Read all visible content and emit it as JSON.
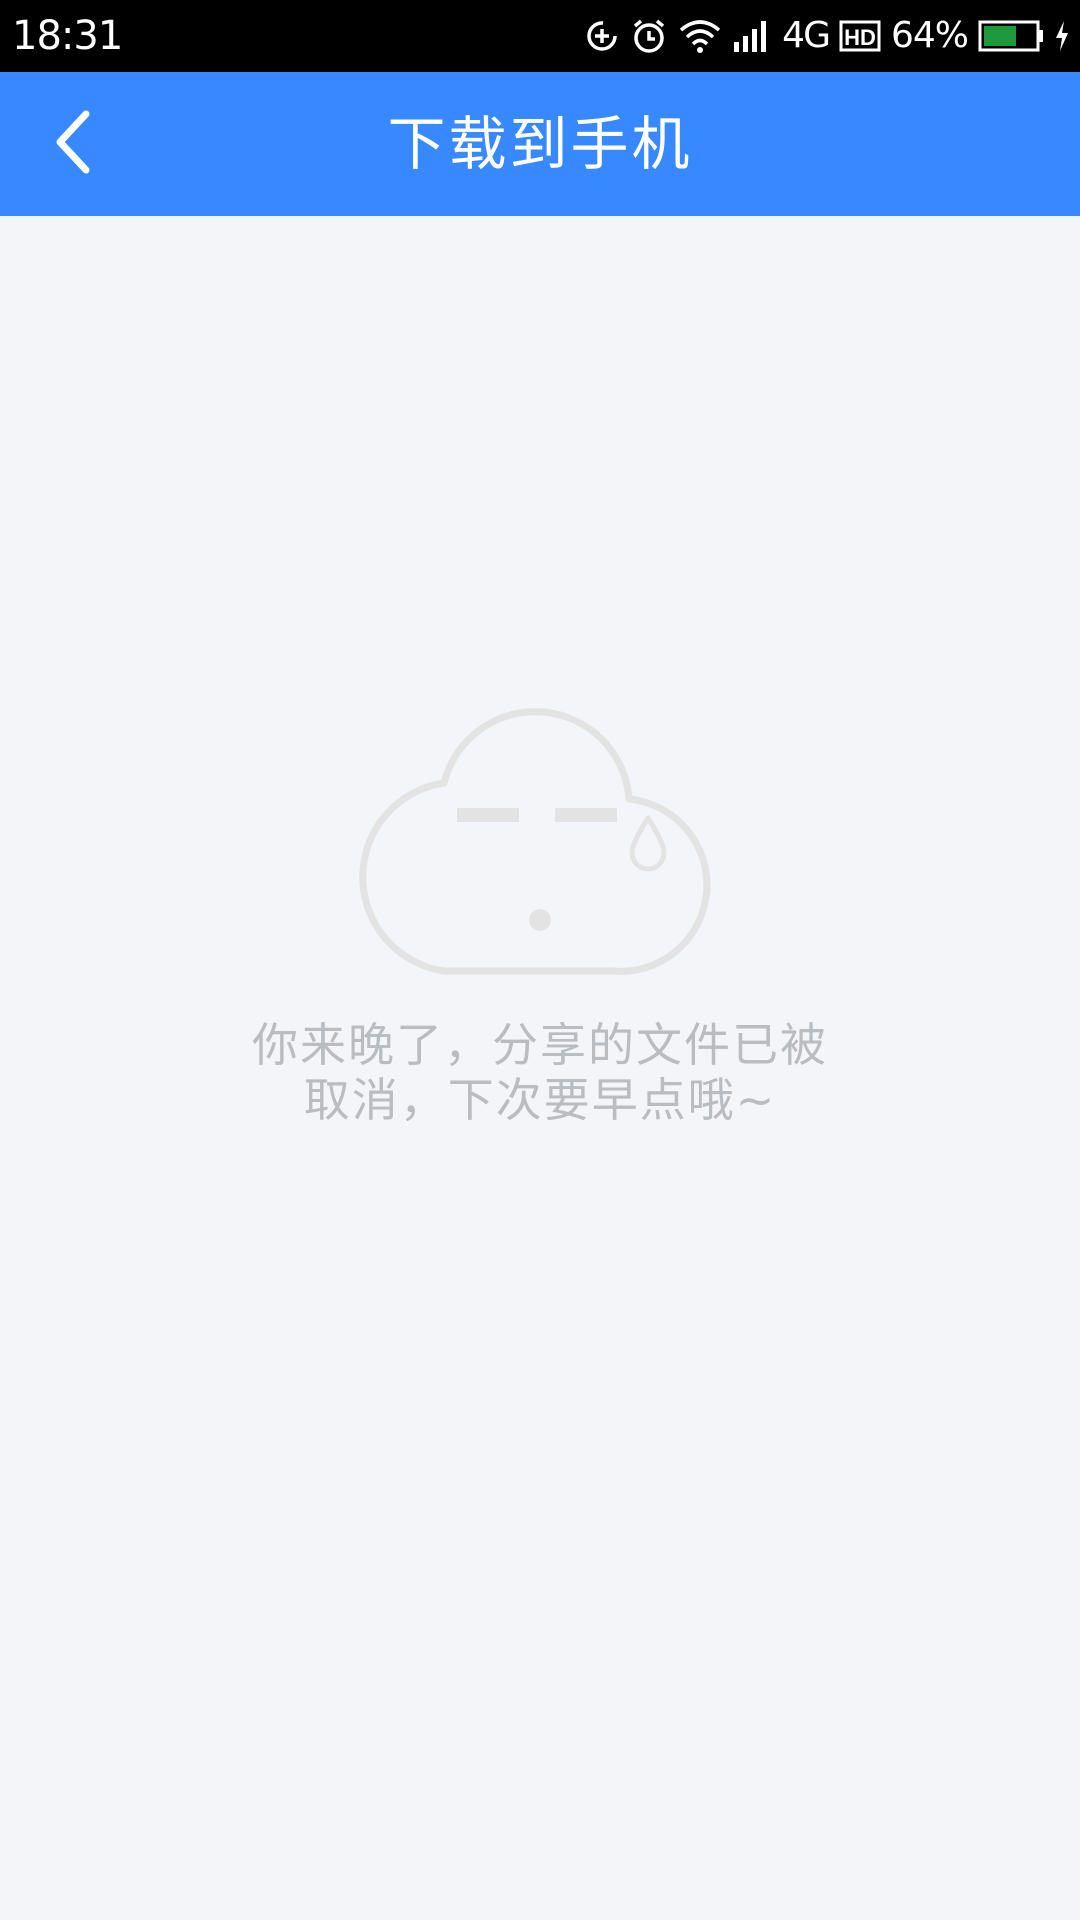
{
  "status_bar": {
    "time": "18:31",
    "network": "4G",
    "hd_badge": "HD",
    "battery_percent": "64%",
    "battery_level": 0.64,
    "battery_color": "#1e9a3c",
    "icons": [
      "sync-icon",
      "alarm-icon",
      "wifi-icon",
      "signal-icon",
      "hd-icon",
      "battery-icon",
      "charging-icon"
    ]
  },
  "app_bar": {
    "background": "#3889ff",
    "title": "下载到手机",
    "back_icon": "chevron-left-icon"
  },
  "empty_state": {
    "illustration": "sad-cloud-icon",
    "message_line1": "你来晚了，分享的文件已被",
    "message_line2": "取消，下次要早点哦~"
  }
}
